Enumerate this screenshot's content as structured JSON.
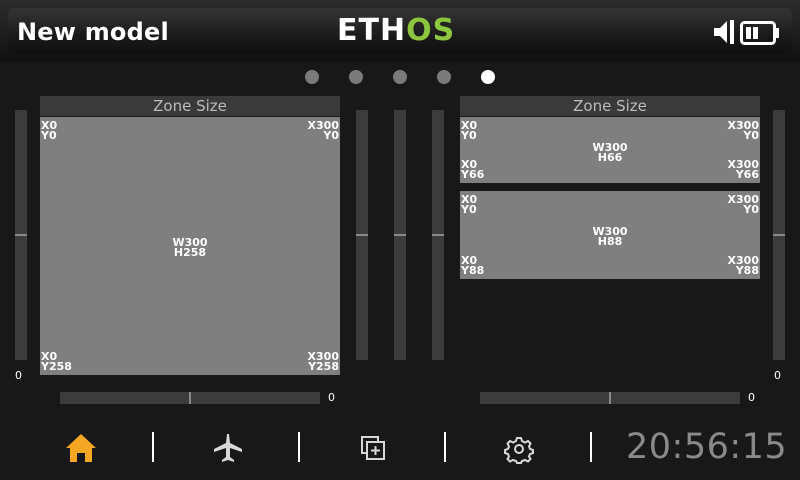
{
  "header": {
    "model_name": "New model",
    "logo_part1": "ETH",
    "logo_part2": "OS",
    "icons": [
      "speaker-muted-icon",
      "battery-icon"
    ]
  },
  "pages": {
    "count": 5,
    "active_index": 4
  },
  "trims": {
    "left_vertical_value": "0",
    "right_vertical_value": "0",
    "left_horizontal_value": "0",
    "right_horizontal_value": "0"
  },
  "zone_left": {
    "title": "Zone Size",
    "tl_x": "X0",
    "tl_y": "Y0",
    "tr_x": "X300",
    "tr_y": "Y0",
    "center_w": "W300",
    "center_h": "H258",
    "bl_x": "X0",
    "bl_y": "Y258",
    "br_x": "X300",
    "br_y": "Y258"
  },
  "zone_right": {
    "title": "Zone Size",
    "top": {
      "tl_x": "X0",
      "tl_y": "Y0",
      "tr_x": "X300",
      "tr_y": "Y0",
      "center_w": "W300",
      "center_h": "H66",
      "bl_x": "X0",
      "bl_y": "Y66",
      "br_x": "X300",
      "br_y": "Y66"
    },
    "bottom": {
      "tl_x": "X0",
      "tl_y": "Y0",
      "tr_x": "X300",
      "tr_y": "Y0",
      "center_w": "W300",
      "center_h": "H88",
      "bl_x": "X0",
      "bl_y": "Y88",
      "br_x": "X300",
      "br_y": "Y88"
    }
  },
  "toolbar": {
    "icons": [
      "home-icon",
      "airplane-icon",
      "add-widget-icon",
      "gear-icon"
    ],
    "active_color": "#f5a623",
    "clock": "20:56:15"
  }
}
